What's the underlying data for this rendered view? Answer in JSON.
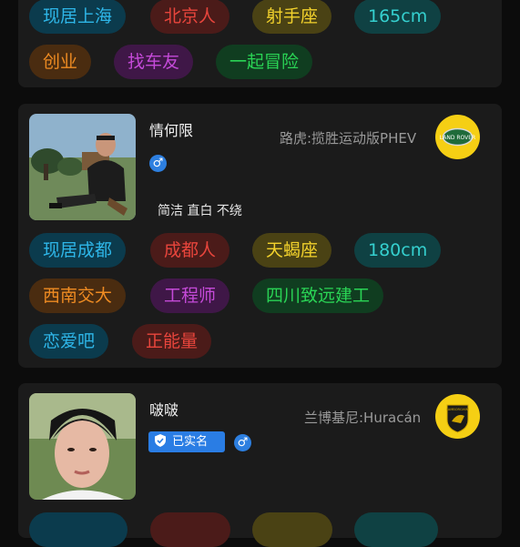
{
  "card1": {
    "tags": [
      "现居上海",
      "北京人",
      "射手座",
      "165cm",
      "创业",
      "找车友",
      "一起冒险"
    ]
  },
  "card2": {
    "name": "情何限",
    "car": "路虎:揽胜运动版PHEV",
    "gender_symbol": "♂",
    "motto": "简洁 直白 不绕",
    "logo_text": "LAND ROVER",
    "tags": [
      "现居成都",
      "成都人",
      "天蝎座",
      "180cm",
      "西南交大",
      "工程师",
      "四川致远建工",
      "恋爱吧",
      "正能量"
    ]
  },
  "card3": {
    "name": "啵啵",
    "car": "兰博基尼:Huracán",
    "gender_symbol": "♂",
    "verified_label": "已实名",
    "logo_text": "LAMBORGHINI"
  },
  "colors": {
    "blue": "#2eb6e8",
    "red": "#e8453c",
    "yellow": "#f3d22c",
    "teal": "#35d0cf",
    "orange": "#ee8b22",
    "purple": "#c44ad8",
    "green": "#2ad455",
    "badge": "#2a7de4"
  }
}
